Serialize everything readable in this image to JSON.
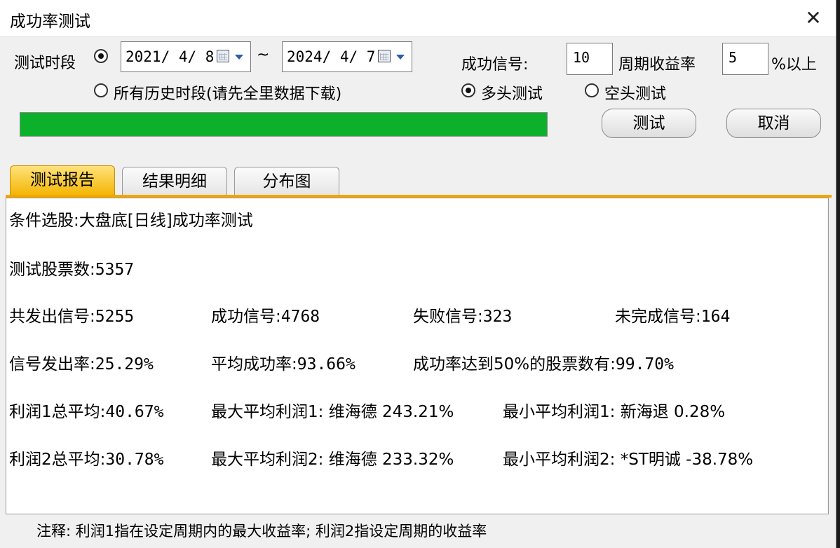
{
  "window": {
    "title": "成功率测试",
    "close_glyph": "✕"
  },
  "controls": {
    "period_label": "测试时段",
    "start_date": "2021/ 4/ 8",
    "range_sep": "~",
    "end_date": "2024/ 4/ 7",
    "all_history_label": "所有历史时段(请先全里数据下载)",
    "success_signal_label": "成功信号:",
    "success_signal_value": "10",
    "period_return_label": "周期收益率",
    "period_return_value": "5",
    "above_label": "%以上",
    "long_test_label": "多头测试",
    "short_test_label": "空头测试",
    "selected_period_mode": "date-range",
    "selected_direction": "long",
    "progress": 1.0,
    "test_button": "测试",
    "cancel_button": "取消"
  },
  "tabs": [
    {
      "label": "测试报告",
      "active": true
    },
    {
      "label": "结果明细",
      "active": false
    },
    {
      "label": "分布图",
      "active": false
    }
  ],
  "report": {
    "condition_label": "条件选股:",
    "condition_value": "大盘底[日线]成功率测试",
    "stock_count_label": "测试股票数:",
    "stock_count_value": "5357",
    "total_signals_label": "共发出信号:",
    "total_signals_value": "5255",
    "success_signals_label": "成功信号:",
    "success_signals_value": "4768",
    "failed_signals_label": "失败信号:",
    "failed_signals_value": "323",
    "incomplete_signals_label": "未完成信号:",
    "incomplete_signals_value": "164",
    "signal_rate_label": "信号发出率:",
    "signal_rate_value": "25.29%",
    "avg_success_label": "平均成功率:",
    "avg_success_value": "93.66%",
    "over50_label": "成功率达到50%的股票数有:",
    "over50_value": "99.70%",
    "profit1_avg_label": "利润1总平均:",
    "profit1_avg_value": "40.67%",
    "max_profit1_label": "最大平均利润1:",
    "max_profit1_value": "维海德 243.21%",
    "min_profit1_label": "最小平均利润1:",
    "min_profit1_value": "新海退 0.28%",
    "profit2_avg_label": "利润2总平均:",
    "profit2_avg_value": "30.78%",
    "max_profit2_label": "最大平均利润2:",
    "max_profit2_value": "维海德 233.32%",
    "min_profit2_label": "最小平均利润2:",
    "min_profit2_value": "*ST明诚 -38.78%"
  },
  "footnote": "注释: 利润1指在设定周期内的最大收益率; 利润2指设定周期的收益率",
  "colors": {
    "progress": "#0db02b",
    "active_tab": "#f3b400",
    "tab_underline": "#f0a800"
  }
}
